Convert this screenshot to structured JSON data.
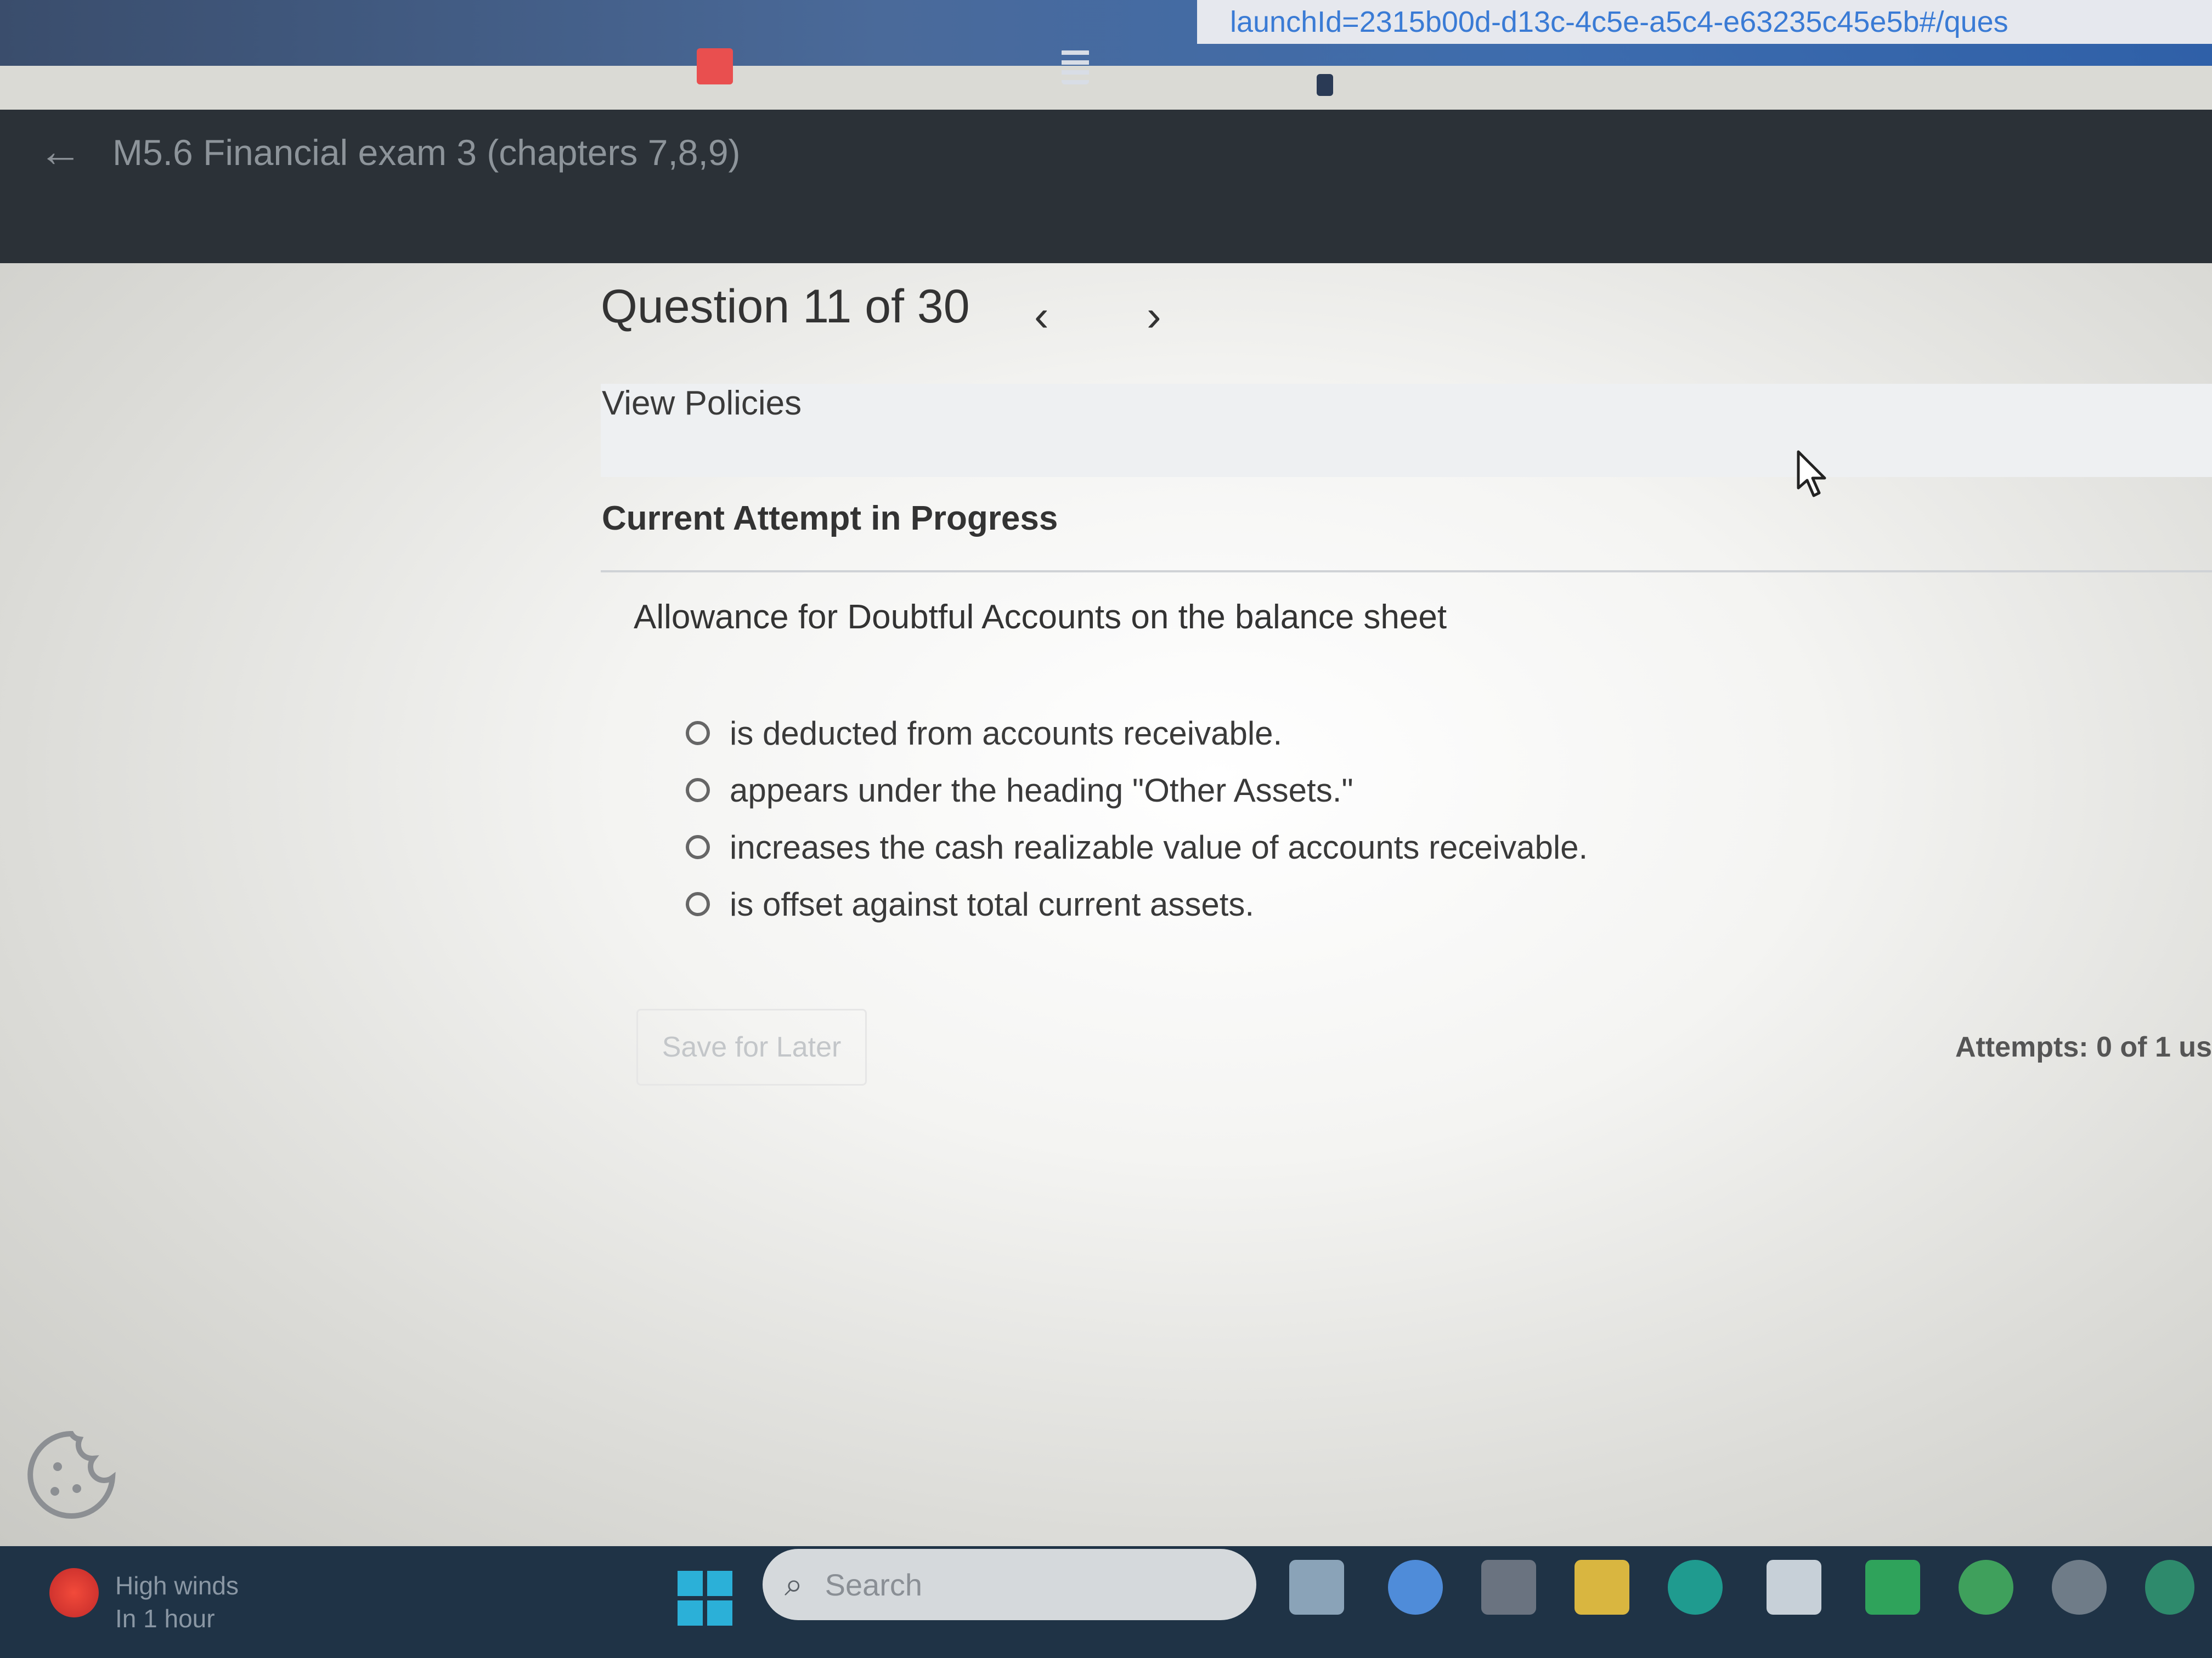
{
  "browser": {
    "url_fragment": "launchId=2315b00d-d13c-4c5e-a5c4-e63235c45e5b#/ques"
  },
  "header": {
    "back_icon": "back-arrow-icon",
    "exam_title": "M5.6 Financial exam 3 (chapters 7,8,9)"
  },
  "question_nav": {
    "label": "Question 11 of 30",
    "prev_icon": "chevron-left-icon",
    "next_icon": "chevron-right-icon"
  },
  "policies": {
    "link_label": "View Policies"
  },
  "attempt": {
    "status_title": "Current Attempt in Progress"
  },
  "question": {
    "text": "Allowance for Doubtful Accounts on the balance sheet",
    "options": [
      {
        "label": "is deducted from accounts receivable.",
        "selected": false
      },
      {
        "label": "appears under the heading \"Other Assets.\"",
        "selected": false
      },
      {
        "label": "increases the cash realizable value of accounts receivable.",
        "selected": false
      },
      {
        "label": "is offset against total current assets.",
        "selected": false
      }
    ]
  },
  "footer": {
    "save_label": "Save for Later",
    "attempts_text": "Attempts: 0 of 1 us"
  },
  "taskbar": {
    "weather_line1": "High winds",
    "weather_line2": "In 1 hour",
    "search_icon": "search-icon",
    "search_placeholder": "Search"
  },
  "colors": {
    "header_bg": "#2b3137",
    "text": "#333333",
    "taskbar_bg": "#1f3346",
    "url_text": "#3a7bd5"
  }
}
